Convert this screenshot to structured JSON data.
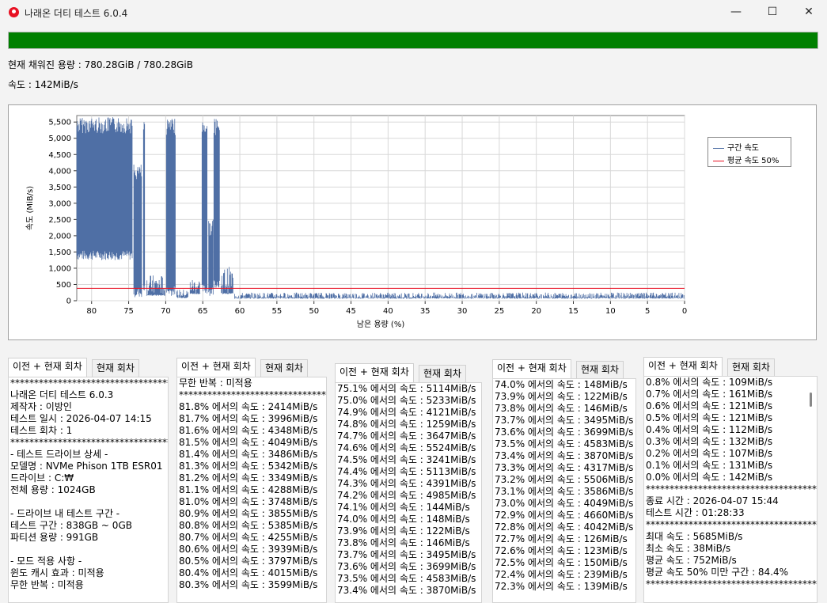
{
  "window": {
    "title": "나래온 더티 테스트 6.0.4",
    "minimize": "—",
    "maximize": "☐",
    "close": "✕"
  },
  "progress": {
    "percent": 100,
    "color": "#008000"
  },
  "filled_label": "현재 채워진 용량 : 780.28GiB / 780.28GiB",
  "speed_label": "속도 : 142MiB/s",
  "chart_data": {
    "type": "line",
    "xlabel": "남은 용량 (%)",
    "ylabel": "속도 (MiB/s)",
    "xlim": [
      82,
      0
    ],
    "ylim": [
      0,
      5700
    ],
    "x_ticks": [
      "80",
      "75",
      "70",
      "65",
      "60",
      "55",
      "50",
      "45",
      "40",
      "35",
      "30",
      "25",
      "20",
      "15",
      "10",
      "5",
      "0"
    ],
    "y_ticks": [
      "5,500",
      "5,000",
      "4,500",
      "4,000",
      "3,500",
      "3,000",
      "2,500",
      "2,000",
      "1,500",
      "1,000",
      "500",
      "0"
    ],
    "series": [
      {
        "name": "구간 속도",
        "color": "#4f6fa5",
        "segments": [
          {
            "x": [
              82,
              74.5
            ],
            "low": 1250,
            "high": 5650
          },
          {
            "x": [
              74.3,
              73.2
            ],
            "low": 100,
            "high": 4200
          },
          {
            "x": [
              73.0,
              72.8
            ],
            "low": 200,
            "high": 5550
          },
          {
            "x": [
              72.6,
              70.1
            ],
            "low": 150,
            "high": 800
          },
          {
            "x": [
              69.9,
              68.7
            ],
            "low": 150,
            "high": 5600
          },
          {
            "x": [
              68.5,
              67.0
            ],
            "low": 80,
            "high": 350
          },
          {
            "x": [
              66.7,
              65.3
            ],
            "low": 200,
            "high": 700
          },
          {
            "x": [
              65.1,
              64.4
            ],
            "low": 200,
            "high": 5600
          },
          {
            "x": [
              64.2,
              63.6
            ],
            "low": 150,
            "high": 2500
          },
          {
            "x": [
              63.5,
              62.7
            ],
            "low": 400,
            "high": 5600
          },
          {
            "x": [
              62.5,
              60.9
            ],
            "low": 200,
            "high": 1050
          },
          {
            "x": [
              60.7,
              0
            ],
            "low": 60,
            "high": 250
          }
        ]
      },
      {
        "name": "평균 속도 50%",
        "color": "#e81123",
        "value": 380
      }
    ]
  },
  "panels": [
    {
      "tab1": "이전 + 현재 회차",
      "tab2": "현재 회차",
      "lines": [
        "**************************************",
        "나래온 더티 테스트 6.0.3",
        "제작자 : 이방인",
        "테스트 일시 : 2026-04-07 14:15",
        "테스트 회차 : 1",
        "**************************************",
        "- 테스트 드라이브 상세 -",
        "모델명 : NVMe    Phison 1TB ESR01",
        "드라이브 : C:₩",
        "전체 용량 : 1024GB",
        "",
        "- 드라이브 내 테스트 구간 -",
        "테스트 구간 : 838GB ~ 0GB",
        "파티션 용량 : 991GB",
        "",
        "- 모드 적용 사항 -",
        "윈도 캐시 효과 : 미적용",
        "무한 반복 : 미적용"
      ]
    },
    {
      "tab1": "이전 + 현재 회차",
      "tab2": "현재 회차",
      "lines": [
        "무한 반복 : 미적용",
        "**************************************",
        "81.8% 에서의 속도 : 2414MiB/s",
        "81.7% 에서의 속도 : 3996MiB/s",
        "81.6% 에서의 속도 : 4348MiB/s",
        "81.5% 에서의 속도 : 4049MiB/s",
        "81.4% 에서의 속도 : 3486MiB/s",
        "81.3% 에서의 속도 : 5342MiB/s",
        "81.2% 에서의 속도 : 3349MiB/s",
        "81.1% 에서의 속도 : 4288MiB/s",
        "81.0% 에서의 속도 : 3748MiB/s",
        "80.9% 에서의 속도 : 3855MiB/s",
        "80.8% 에서의 속도 : 5385MiB/s",
        "80.7% 에서의 속도 : 4255MiB/s",
        "80.6% 에서의 속도 : 3939MiB/s",
        "80.5% 에서의 속도 : 3797MiB/s",
        "80.4% 에서의 속도 : 4015MiB/s",
        "80.3% 에서의 속도 : 3599MiB/s"
      ]
    },
    {
      "tab1": "이전 + 현재 회차",
      "tab2": "현재 회차",
      "lines": [
        "75.1% 에서의 속도 : 5114MiB/s",
        "75.0% 에서의 속도 : 5233MiB/s",
        "74.9% 에서의 속도 : 4121MiB/s",
        "74.8% 에서의 속도 : 1259MiB/s",
        "74.7% 에서의 속도 : 3647MiB/s",
        "74.6% 에서의 속도 : 5524MiB/s",
        "74.5% 에서의 속도 : 3241MiB/s",
        "74.4% 에서의 속도 : 5113MiB/s",
        "74.3% 에서의 속도 : 4391MiB/s",
        "74.2% 에서의 속도 : 4985MiB/s",
        "74.1% 에서의 속도 : 144MiB/s",
        "74.0% 에서의 속도 : 148MiB/s",
        "73.9% 에서의 속도 : 122MiB/s",
        "73.8% 에서의 속도 : 146MiB/s",
        "73.7% 에서의 속도 : 3495MiB/s",
        "73.6% 에서의 속도 : 3699MiB/s",
        "73.5% 에서의 속도 : 4583MiB/s",
        "73.4% 에서의 속도 : 3870MiB/s"
      ]
    },
    {
      "tab1": "이전 + 현재 회차",
      "tab2": "현재 회차",
      "lines": [
        "74.0% 에서의 속도 : 148MiB/s",
        "73.9% 에서의 속도 : 122MiB/s",
        "73.8% 에서의 속도 : 146MiB/s",
        "73.7% 에서의 속도 : 3495MiB/s",
        "73.6% 에서의 속도 : 3699MiB/s",
        "73.5% 에서의 속도 : 4583MiB/s",
        "73.4% 에서의 속도 : 3870MiB/s",
        "73.3% 에서의 속도 : 4317MiB/s",
        "73.2% 에서의 속도 : 5506MiB/s",
        "73.1% 에서의 속도 : 3586MiB/s",
        "73.0% 에서의 속도 : 4049MiB/s",
        "72.9% 에서의 속도 : 4660MiB/s",
        "72.8% 에서의 속도 : 4042MiB/s",
        "72.7% 에서의 속도 : 126MiB/s",
        "72.6% 에서의 속도 : 123MiB/s",
        "72.5% 에서의 속도 : 150MiB/s",
        "72.4% 에서의 속도 : 239MiB/s",
        "72.3% 에서의 속도 : 139MiB/s"
      ]
    },
    {
      "tab1": "이전 + 현재 회차",
      "tab2": "현재 회차",
      "lines": [
        "0.8% 에서의 속도 : 109MiB/s",
        "0.7% 에서의 속도 : 161MiB/s",
        "0.6% 에서의 속도 : 121MiB/s",
        "0.5% 에서의 속도 : 121MiB/s",
        "0.4% 에서의 속도 : 112MiB/s",
        "0.3% 에서의 속도 : 132MiB/s",
        "0.2% 에서의 속도 : 107MiB/s",
        "0.1% 에서의 속도 : 131MiB/s",
        "0.0% 에서의 속도 : 142MiB/s",
        "**************************************",
        "종료 시간 : 2026-04-07 15:44",
        "테스트 시간 : 01:28:33",
        "**************************************",
        "최대 속도 : 5685MiB/s",
        "최소 속도 : 38MiB/s",
        "평균 속도 : 752MiB/s",
        "평균 속도 50% 미만 구간 : 84.4%",
        "**************************************"
      ]
    }
  ]
}
